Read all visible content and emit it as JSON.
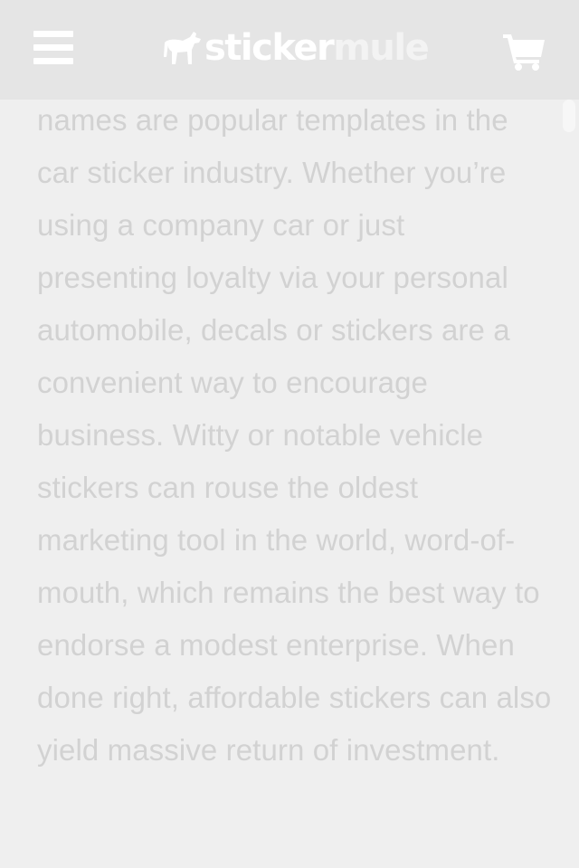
{
  "header": {
    "logo": {
      "word1": "sticker",
      "word2": "mule"
    },
    "menu_icon": "hamburger-menu-icon",
    "cart_icon": "shopping-cart-icon",
    "colors": {
      "header_bg": "#e5e5e5",
      "icon": "#ffffff"
    }
  },
  "article": {
    "paragraph": "names are popular templates in the car sticker industry. Whether you’re using a company car or just presenting loyalty via your personal automobile, decals or stickers are a convenient way to encourage business. Witty or notable vehicle stickers can rouse the oldest marketing tool in the world, word-of-mouth, which remains the best way to endorse a modest enterprise. When done right, affordable stickers can also yield massive return of investment."
  }
}
